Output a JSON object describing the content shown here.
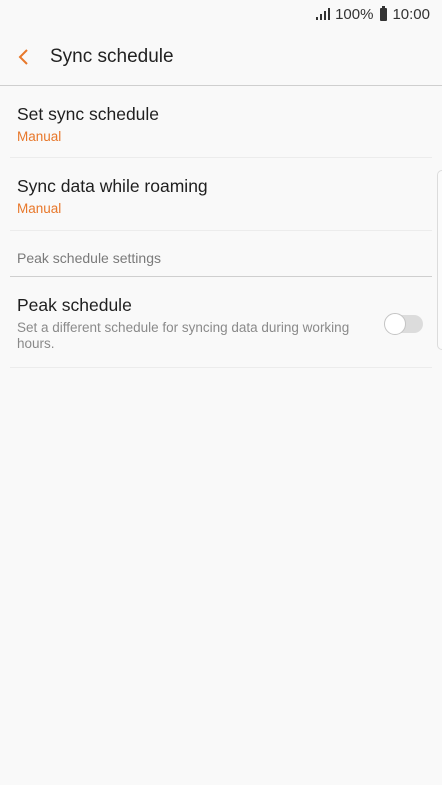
{
  "status_bar": {
    "battery": "100%",
    "time": "10:00"
  },
  "header": {
    "title": "Sync schedule"
  },
  "items": [
    {
      "title": "Set sync schedule",
      "value": "Manual"
    },
    {
      "title": "Sync data while roaming",
      "value": "Manual"
    }
  ],
  "section": {
    "label": "Peak schedule settings"
  },
  "peak": {
    "title": "Peak schedule",
    "description": "Set a different schedule for syncing data during working hours.",
    "enabled": false
  },
  "colors": {
    "accent": "#e8782b",
    "background": "#f9f9f9"
  }
}
